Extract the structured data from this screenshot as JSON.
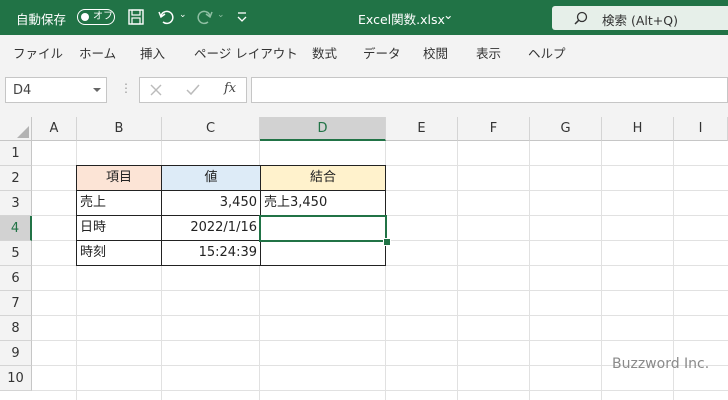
{
  "titlebar": {
    "autosave_label": "自動保存",
    "autosave_state": "オフ",
    "filename": "Excel関数.xlsx",
    "filename_caret": "⌄",
    "search_text": "検索 (Alt+Q)",
    "bg_color": "#217346"
  },
  "menu": {
    "items": [
      "ファイル",
      "ホーム",
      "挿入",
      "ページ レイアウト",
      "数式",
      "データ",
      "校閲",
      "表示",
      "ヘルプ"
    ]
  },
  "formula_bar": {
    "name_box": "D4",
    "fx_label": "fx",
    "content": ""
  },
  "sheet": {
    "columns": [
      "A",
      "B",
      "C",
      "D",
      "E",
      "F",
      "G",
      "H",
      "I"
    ],
    "rows": [
      "1",
      "2",
      "3",
      "4",
      "5",
      "6",
      "7",
      "8",
      "9",
      "10"
    ],
    "selected_cell": "D4",
    "table": {
      "headers": [
        "項目",
        "値",
        "結合"
      ],
      "header_colors": [
        "#fce4d6",
        "#ddebf7",
        "#fff2cc"
      ],
      "rows": [
        [
          "売上",
          "3,450",
          "売上3,450"
        ],
        [
          "日時",
          "2022/1/16",
          ""
        ],
        [
          "時刻",
          "15:24:39",
          ""
        ]
      ]
    }
  },
  "watermark": "Buzzword Inc."
}
